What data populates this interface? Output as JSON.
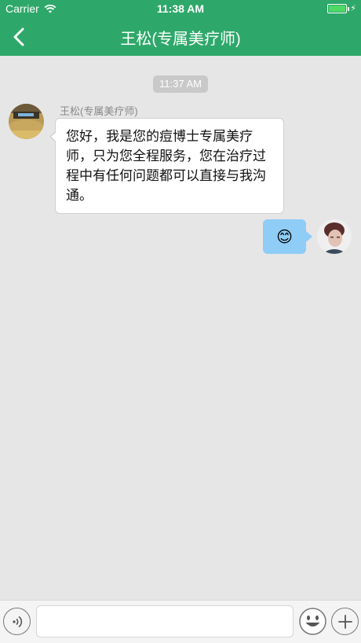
{
  "status_bar": {
    "carrier": "Carrier",
    "time": "11:38 AM",
    "battery_level": 1.0,
    "battery_color": "#4cd964"
  },
  "header": {
    "title": "王松(专属美疗师)",
    "back_icon": "chevron-left-icon",
    "background_color": "#2ea86a"
  },
  "chat": {
    "timestamp": "11:37 AM",
    "messages": [
      {
        "side": "left",
        "sender": "王松(专属美疗师)",
        "text": "您好，我是您的痘博士专属美疗师，只为您全程服务，您在治疗过程中有任何问题都可以直接与我沟通。"
      },
      {
        "side": "right",
        "text": "😊",
        "bubble_color": "#8fccf6"
      }
    ]
  },
  "input_bar": {
    "voice_icon": "voice-icon",
    "input_value": "",
    "emoji_icon": "emoji-icon",
    "plus_icon": "plus-icon"
  }
}
